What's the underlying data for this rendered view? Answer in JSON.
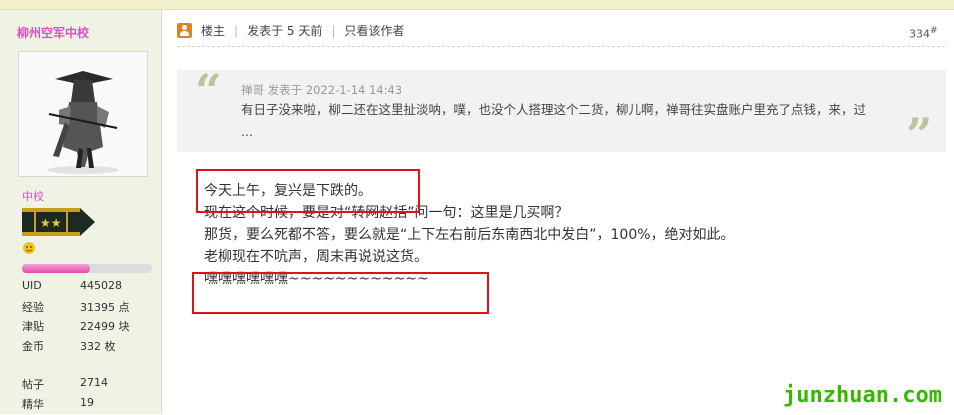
{
  "sidebar": {
    "author_name": "柳州空军中校",
    "rank": "中校",
    "progress_fraction": 0.52,
    "stats": [
      {
        "label": "UID",
        "value": "445028"
      },
      {
        "label": "经验",
        "value": "31395 点"
      },
      {
        "label": "津贴",
        "value": "22499 块"
      },
      {
        "label": "金币",
        "value": "332 枚"
      }
    ],
    "stats2": [
      {
        "label": "帖子",
        "value": "2714"
      },
      {
        "label": "精华",
        "value": "19"
      }
    ]
  },
  "post": {
    "louzhu": "楼主",
    "posted": "发表于 5 天前",
    "only_author": "只看该作者",
    "floor": "334",
    "floor_mark": "#"
  },
  "quote": {
    "open": "“",
    "close": "”",
    "meta": "禅哥 发表于 2022-1-14 14:43",
    "text": "有日子没来啦，柳二还在这里扯淡呐，噗，也没个人搭理这个二货，柳儿啊，禅哥往实盘账户里充了点钱，来，过 ..."
  },
  "body": {
    "lines": [
      "今天上午，复兴是下跌的。",
      "现在这个时候，要是对“转网赵括”问一句：这里是几买啊？",
      "那货，要么死都不答，要么就是“上下左右前后东南西北中发白”，100%，绝对如此。",
      "老柳现在不吭声，周末再说说这货。",
      "嘿嘿嘿嘿嘿嘿~~~~~~~~~~~~"
    ]
  },
  "watermark": "junzhuan.com",
  "colors": {
    "accent": "#e14fc3",
    "highlight": "#e0101c",
    "watermark": "#37b800"
  }
}
